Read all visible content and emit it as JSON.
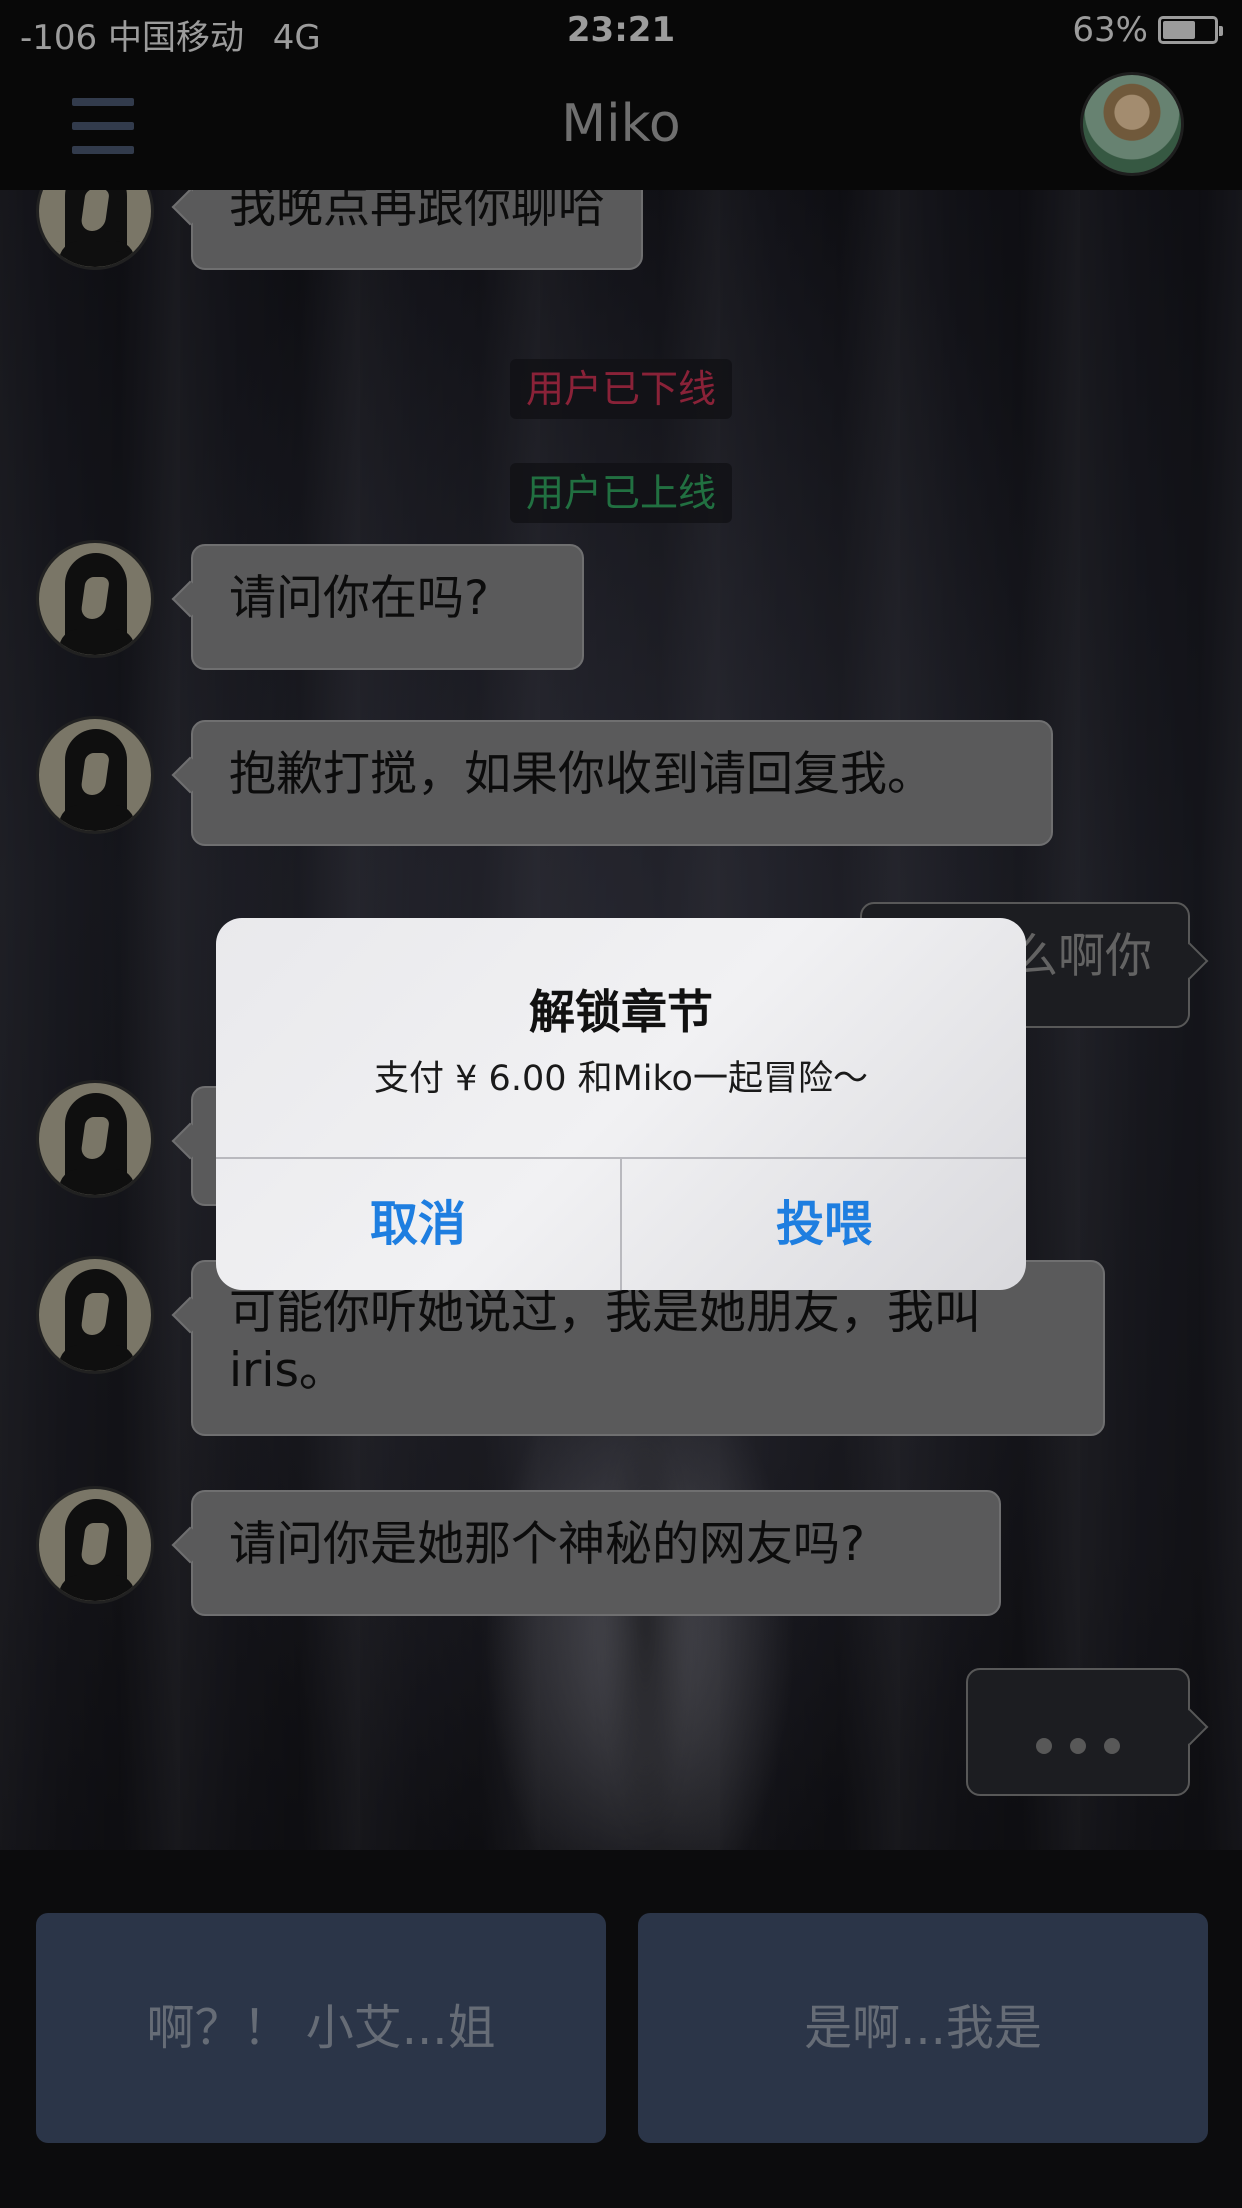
{
  "status_bar": {
    "carrier": "-106 中国移动",
    "network": "4G",
    "time": "23:21",
    "battery": "63%",
    "battery_level": 0.63
  },
  "navbar": {
    "title": "Miko",
    "menu_icon": "hamburger-menu-icon",
    "avatar_icon": "profile-avatar"
  },
  "messages": [
    {
      "type": "incoming",
      "text": "我晚点再跟你聊哈"
    },
    {
      "type": "system",
      "text": "用户已下线",
      "color": "#c0304e"
    },
    {
      "type": "system",
      "text": "用户已上线",
      "color": "#2f9c5a"
    },
    {
      "type": "incoming",
      "text": "请问你在吗?"
    },
    {
      "type": "incoming",
      "text": "抱歉打搅，如果你收到请回复我。"
    },
    {
      "type": "outgoing",
      "text": "么啊你"
    },
    {
      "type": "incoming",
      "text": ""
    },
    {
      "type": "incoming",
      "text": "可能你听她说过，我是她朋友，我叫iris。"
    },
    {
      "type": "incoming",
      "text": "请问你是她那个神秘的网友吗?"
    },
    {
      "type": "typing",
      "text": ""
    }
  ],
  "choices": [
    {
      "label": "啊？！ 小艾...姐"
    },
    {
      "label": "是啊...我是"
    }
  ],
  "dialog": {
    "title": "解锁章节",
    "message": "支付 ¥ 6.00 和Miko一起冒险～",
    "cancel_label": "取消",
    "confirm_label": "投喂",
    "button_color": "#1e7ee0"
  }
}
